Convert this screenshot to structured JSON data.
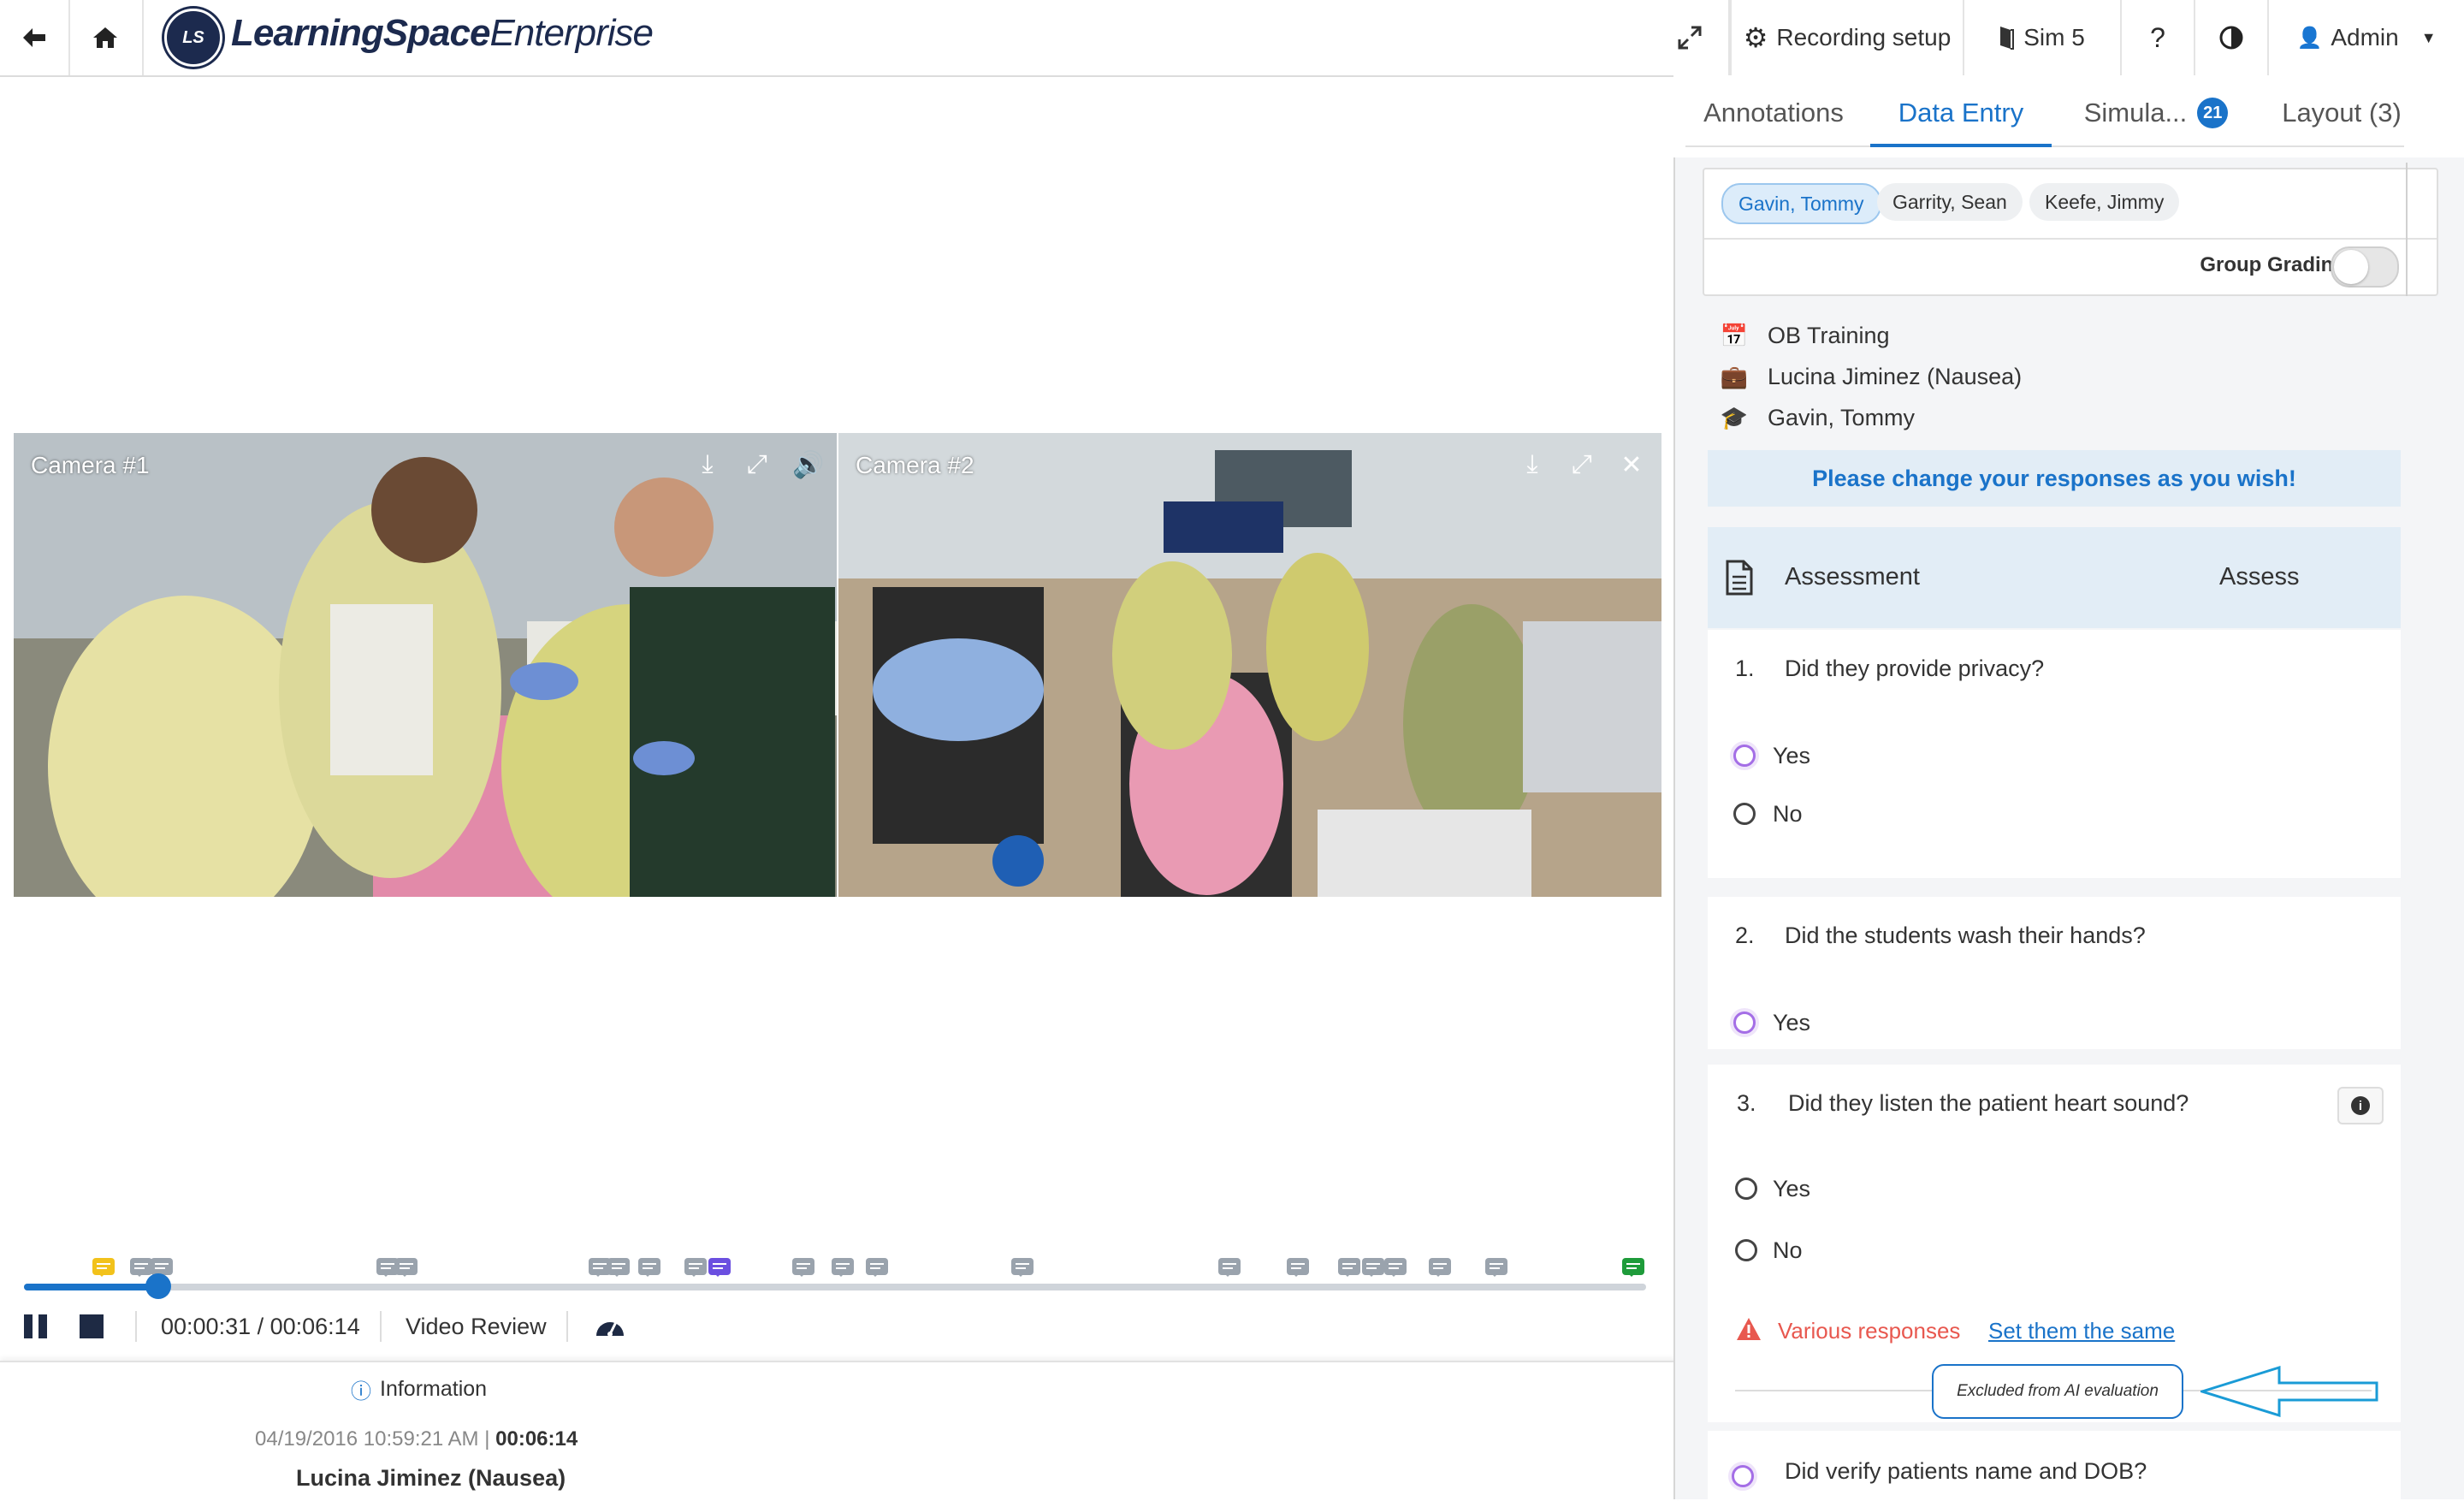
{
  "header": {
    "logo_badge": "LS",
    "logo_main": "LearningSpace",
    "logo_sub": "Enterprise",
    "recording_setup": "Recording setup",
    "sim": "Sim 5",
    "help": "?",
    "user": "Admin"
  },
  "cameras": [
    {
      "label": "Camera #1"
    },
    {
      "label": "Camera #2"
    }
  ],
  "playback": {
    "time": "00:00:31 / 00:06:14",
    "mode": "Video Review",
    "progress_fraction": 0.083
  },
  "info": {
    "title": "Information",
    "datetime": "04/19/2016 10:59:21 AM",
    "separator": "|",
    "duration": "00:06:14",
    "scenario": "Lucina Jiminez (Nausea)"
  },
  "tabs": {
    "annotations": "Annotations",
    "data_entry": "Data Entry",
    "simulation": "Simula...",
    "simulation_count": "21",
    "layout": "Layout (3)"
  },
  "students": {
    "chips": [
      "Gavin, Tommy",
      "Garrity, Sean",
      "Keefe, Jimmy"
    ],
    "group_grading": "Group Grading"
  },
  "meta": {
    "course": "OB Training",
    "case": "Lucina Jiminez (Nausea)",
    "learner": "Gavin, Tommy"
  },
  "notice": "Please change your responses as you wish!",
  "assessment": {
    "title": "Assessment",
    "column": "Assess"
  },
  "questions": [
    {
      "num": "1.",
      "text": "Did they provide privacy?",
      "options": [
        "Yes",
        "No"
      ]
    },
    {
      "num": "2.",
      "text": "Did the students wash their hands?",
      "options": [
        "Yes"
      ]
    },
    {
      "num": "3.",
      "text": "Did they listen the patient heart sound?",
      "options": [
        "Yes",
        "No"
      ]
    },
    {
      "num": "",
      "text": "Did verify patients name and DOB?",
      "options": []
    }
  ],
  "warning": {
    "text": "Various responses",
    "action": "Set them the same"
  },
  "excluded_label": "Excluded from AI evaluation",
  "colors": {
    "accent": "#1a73c9",
    "warning": "#e8584f",
    "radio_highlight": "#a46ee6",
    "marker_yellow": "#f2c21b",
    "marker_purple": "#6b4fe0",
    "marker_green": "#1e9b3a",
    "marker_gray": "#9aa3ad"
  }
}
